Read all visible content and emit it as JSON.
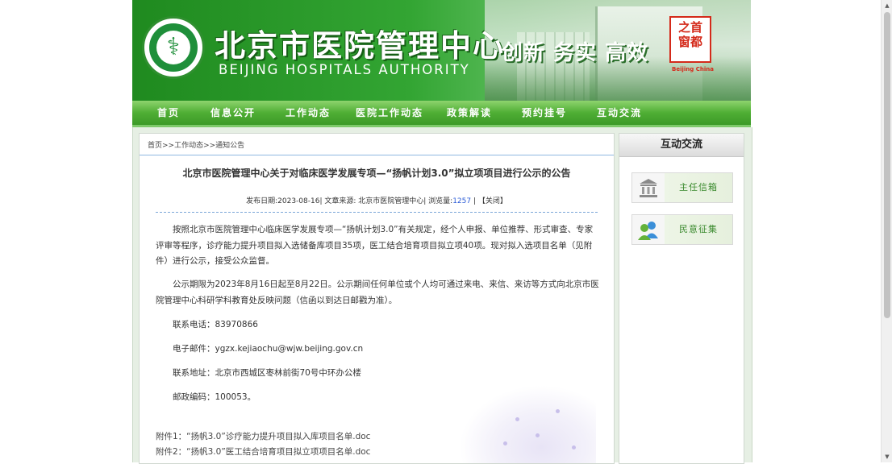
{
  "banner": {
    "title_cn": "北京市医院管理中心",
    "title_en": "BEIJING HOSPITALS AUTHORITY",
    "slogan": "创新 务实 高效",
    "seal_text": "之首\n窗都",
    "seal_en": "Beijing China"
  },
  "nav": [
    "首页",
    "信息公开",
    "工作动态",
    "医院工作动态",
    "政策解读",
    "预约挂号",
    "互动交流"
  ],
  "breadcrumb": "首页>>工作动态>>通知公告",
  "article": {
    "title": "北京市医院管理中心关于对临床医学发展专项—“扬帆计划3.0”拟立项项目进行公示的公告",
    "meta_prefix": "发布日期:2023-08-16| 文章来源: 北京市医院管理中心| 浏览量:",
    "views": "1257",
    "meta_suffix": " | 【关闭】",
    "para1": "按照北京市医院管理中心临床医学发展专项—“扬帆计划3.0”有关规定，经个人申报、单位推荐、形式审查、专家评审等程序，诊疗能力提升项目拟入选储备库项目35项，医工结合培育项目拟立项40项。现对拟入选项目名单（见附件）进行公示，接受公众监督。",
    "para2": "公示期限为2023年8月16日起至8月22日。公示期间任何单位或个人均可通过来电、来信、来访等方式向北京市医院管理中心科研学科教育处反映问题（信函以到达日邮戳为准）。",
    "phone": "联系电话：83970866",
    "email": "电子邮件：ygzx.kejiaochu@wjw.beijing.gov.cn",
    "address": "联系地址：北京市西城区枣林前街70号中环办公楼",
    "postcode": "邮政编码：100053。",
    "attachments": [
      "附件1：“扬帆3.0”诊疗能力提升项目拟入库项目名单.doc",
      "附件2：“扬帆3.0”医工结合培育项目拟立项项目名单.doc"
    ]
  },
  "sidebar": {
    "heading": "互动交流",
    "tiles": [
      "主任信箱",
      "民意征集"
    ]
  },
  "colors": {
    "brand_green": "#2f9a2f",
    "link_blue": "#2a5bd7",
    "tile_text": "#3b8a2e"
  }
}
